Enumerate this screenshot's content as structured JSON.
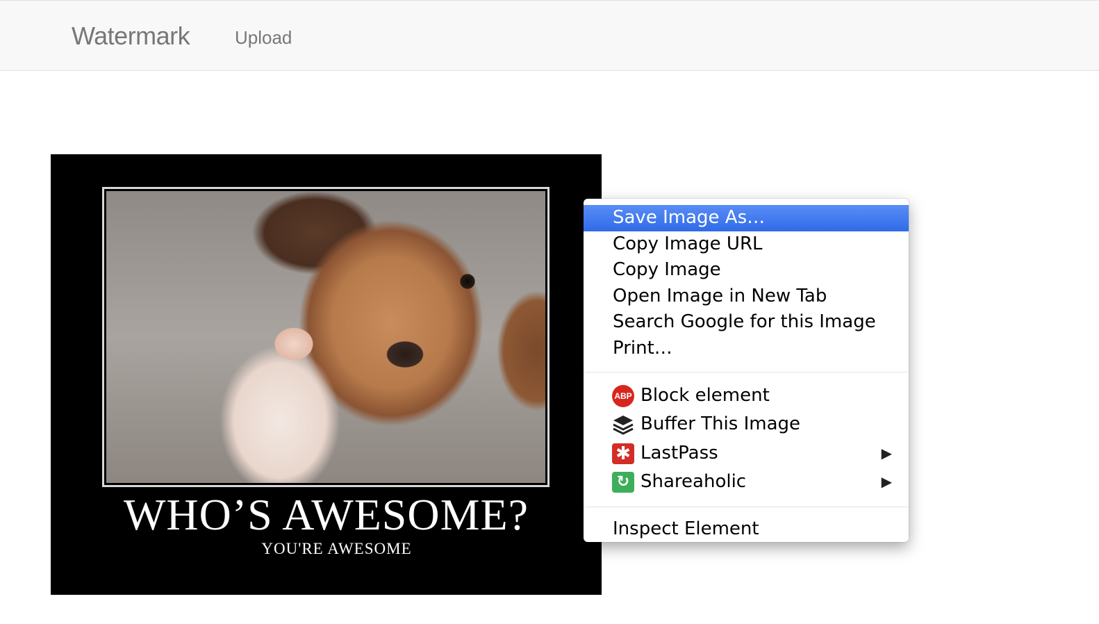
{
  "navbar": {
    "brand": "Watermark",
    "links": [
      "Upload"
    ]
  },
  "poster": {
    "title": "WHO’S AWESOME?",
    "subtitle": "YOU'RE AWESOME"
  },
  "context_menu": {
    "items": [
      {
        "label": "Save Image As…",
        "highlighted": true
      },
      {
        "label": "Copy Image URL"
      },
      {
        "label": "Copy Image"
      },
      {
        "label": "Open Image in New Tab"
      },
      {
        "label": "Search Google for this Image"
      },
      {
        "label": "Print…"
      }
    ],
    "extensions": [
      {
        "label": "Block element",
        "icon": "adblock-plus-icon",
        "icon_text": "ABP",
        "color": "#d7261e"
      },
      {
        "label": "Buffer This Image",
        "icon": "buffer-icon",
        "icon_text": "≋"
      },
      {
        "label": "LastPass",
        "icon": "lastpass-icon",
        "icon_text": "✱",
        "color": "#d32d27",
        "submenu": true
      },
      {
        "label": "Shareaholic",
        "icon": "shareaholic-icon",
        "icon_text": "↻",
        "color": "#3dae5a",
        "submenu": true
      }
    ],
    "footer": [
      {
        "label": "Inspect Element"
      }
    ],
    "highlight_color": "#2f6be9"
  }
}
